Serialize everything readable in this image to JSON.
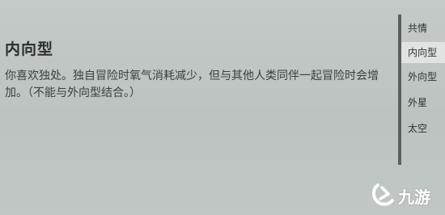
{
  "trait": {
    "title": "内向型",
    "description": "你喜欢独处。独自冒险时氧气消耗减少，但与其他人类同伴一起冒险时会增加。（不能与外向型结合。）"
  },
  "trait_list": {
    "items": [
      {
        "label": "共情"
      },
      {
        "label": "内向型"
      },
      {
        "label": "外向型"
      },
      {
        "label": "外星"
      },
      {
        "label": "太空"
      }
    ],
    "selected_index": 1
  },
  "watermark": {
    "text": "九游",
    "icon": "jiuyou-logo-icon",
    "color": "#ffffff"
  }
}
